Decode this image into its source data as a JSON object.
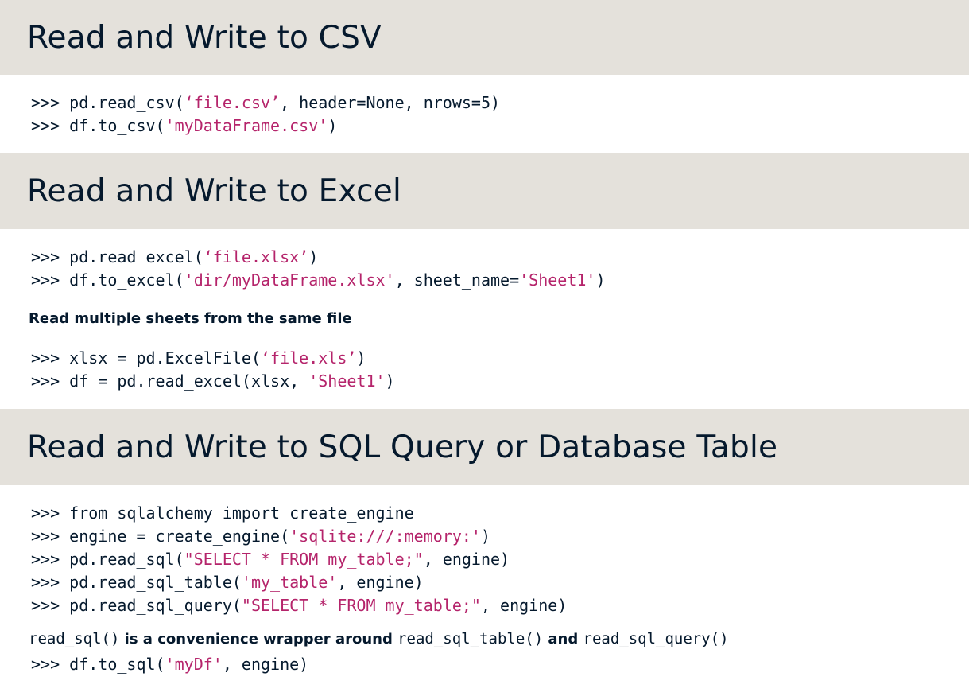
{
  "sections": [
    {
      "title": "Read and Write to CSV",
      "code": [
        {
          "prompt": ">>> ",
          "a": "pd.read_csv(",
          "s": "‘file.csv’",
          "b": ", header=None, nrows=5)"
        },
        {
          "prompt": ">>> ",
          "a": "df.to_csv(",
          "s": "'myDataFrame.csv'",
          "b": ")"
        }
      ]
    },
    {
      "title": "Read and Write to Excel",
      "code": [
        {
          "prompt": ">>> ",
          "a": "pd.read_excel(",
          "s": "‘file.xlsx’",
          "b": ")"
        },
        {
          "prompt": ">>> ",
          "a": "df.to_excel(",
          "s": "'dir/myDataFrame.xlsx'",
          "b": ", sheet_name=",
          "s2": "'Sheet1'",
          "c": ")"
        }
      ],
      "note": "Read multiple sheets from the same file",
      "code2": [
        {
          "prompt": ">>> ",
          "a": "xlsx = pd.ExcelFile(",
          "s": "‘file.xls’",
          "b": ")"
        },
        {
          "prompt": ">>> ",
          "a": "df = pd.read_excel(xlsx, ",
          "s": "'Sheet1'",
          "b": ")"
        }
      ]
    },
    {
      "title": "Read and Write to SQL Query or Database Table",
      "code": [
        {
          "prompt": ">>> ",
          "a": "from sqlalchemy import create_engine",
          "s": "",
          "b": ""
        },
        {
          "prompt": ">>> ",
          "a": "engine = create_engine(",
          "s": "'sqlite:///:memory:'",
          "b": ")"
        },
        {
          "prompt": ">>> ",
          "a": "pd.read_sql(",
          "s": "\"SELECT * FROM my_table;\"",
          "b": ", engine)"
        },
        {
          "prompt": ">>> ",
          "a": "pd.read_sql_table(",
          "s": "'my_table'",
          "b": ", engine)"
        },
        {
          "prompt": ">>> ",
          "a": "pd.read_sql_query(",
          "s": "\"SELECT * FROM my_table;\"",
          "b": ", engine)"
        }
      ],
      "note_parts": {
        "m1": "read_sql()",
        "t1": " is a convenience wrapper around ",
        "m2": "read_sql_table()",
        "t2": " and ",
        "m3": "read_sql_query()"
      },
      "code2": [
        {
          "prompt": ">>> ",
          "a": "df.to_sql(",
          "s": "'myDf'",
          "b": ", engine)"
        }
      ]
    }
  ]
}
